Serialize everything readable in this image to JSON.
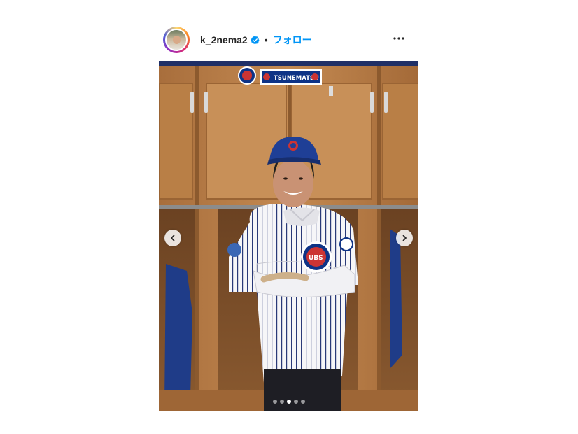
{
  "post": {
    "username": "k_2nema2",
    "separator": "•",
    "follow_label": "フォロー",
    "verified": true,
    "more_icon": "more-horizontal-icon"
  },
  "photo": {
    "nameplate": "TSUNEMATSU",
    "jersey_text": "UBS",
    "carousel_count": 5,
    "carousel_active_index": 2
  },
  "colors": {
    "follow": "#0095f6",
    "text": "#262626",
    "cubs_blue": "#0e3386",
    "cubs_red": "#cc3433"
  }
}
